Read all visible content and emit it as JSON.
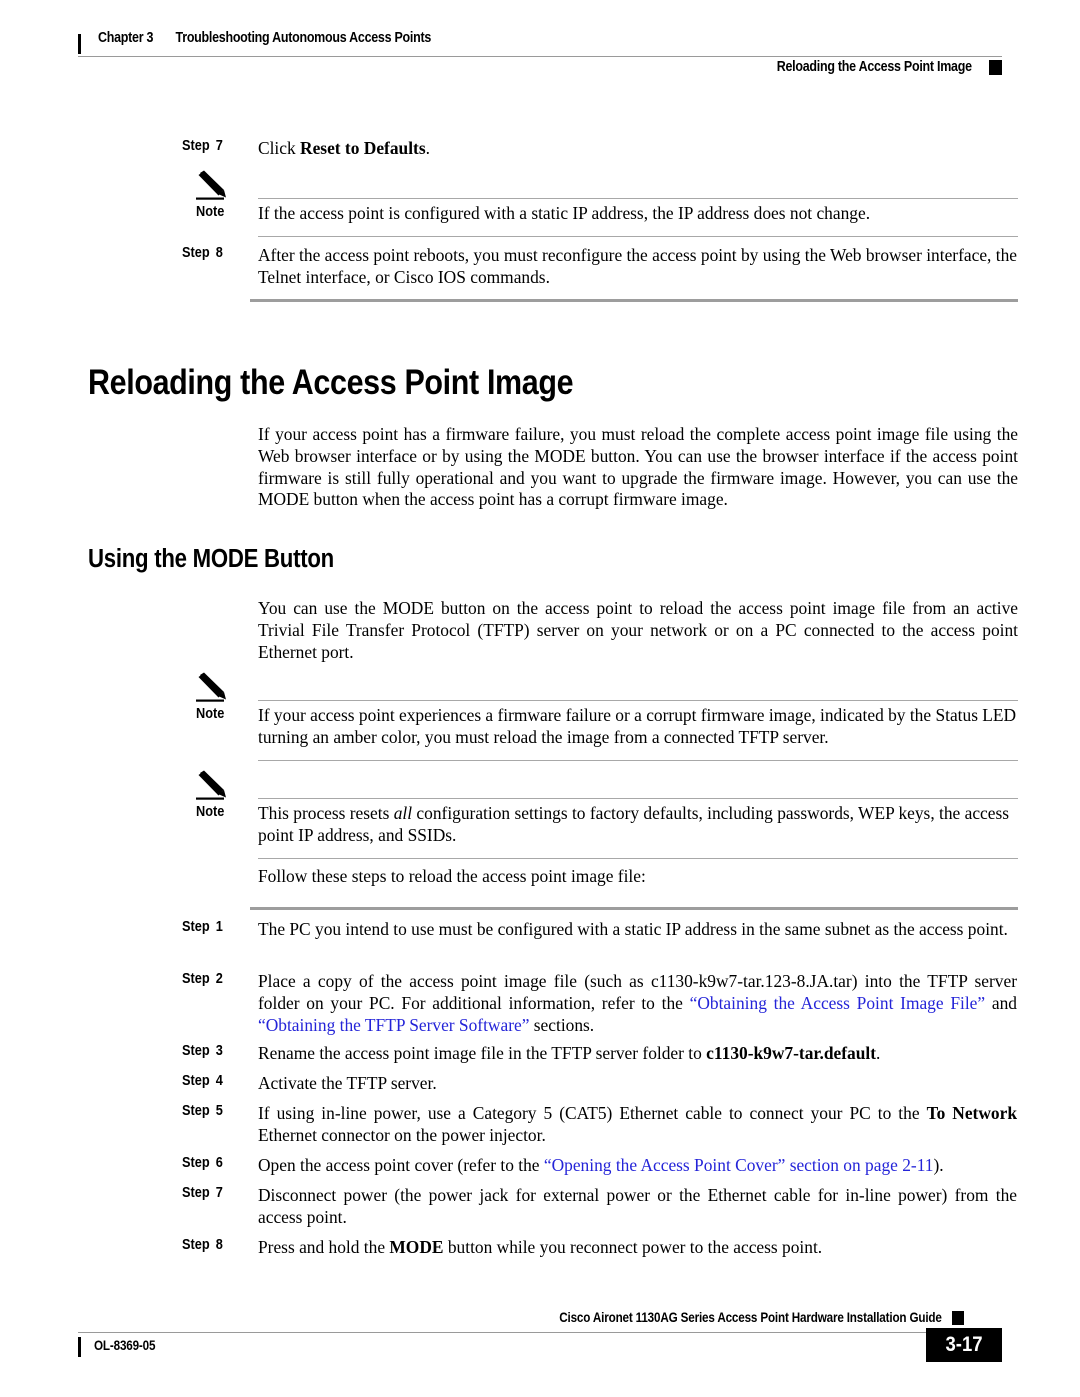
{
  "header": {
    "chapter_label": "Chapter 3",
    "chapter_title": "Troubleshooting Autonomous Access Points",
    "section_title": "Reloading the Access Point Image"
  },
  "top_steps": [
    {
      "label_word": "Step",
      "label_num": "7",
      "text_plain": "Click Reset to Defaults.",
      "text_lead": "Click ",
      "text_bold": "Reset to Defaults",
      "text_tail": "."
    },
    {
      "label_word": "Step",
      "label_num": "8",
      "text_plain": "After the access point reboots, you must reconfigure the access point by using the Web browser interface, the Telnet interface, or Cisco IOS commands."
    }
  ],
  "top_note": {
    "label": "Note",
    "icon": "pencil-icon",
    "text": "If the access point is configured with a static IP address, the IP address does not change."
  },
  "heading_1": "Reloading the Access Point Image",
  "intro_paragraph": "If your access point has a firmware failure, you must reload the complete access point image file using the Web browser interface or by using the MODE button. You can use the browser interface if the access point firmware is still fully operational and you want to upgrade the firmware image. However, you can use the MODE button when the access point has a corrupt firmware image.",
  "heading_2": "Using the MODE Button",
  "mode_paragraph": "You can use the MODE button on the access point to reload the access point image file from an active Trivial File Transfer Protocol (TFTP) server on your network or on a PC connected to the access point Ethernet port.",
  "notes": [
    {
      "label": "Note",
      "icon": "pencil-icon",
      "text": "If your access point experiences a firmware failure or a corrupt firmware image, indicated by the Status LED turning an amber color, you must reload the image from a connected TFTP server."
    },
    {
      "label": "Note",
      "icon": "pencil-icon",
      "text_lead": "This process resets ",
      "text_italic": "all",
      "text_tail": " configuration settings to factory defaults, including passwords, WEP keys, the access point IP address, and SSIDs.",
      "text": "This process resets all configuration settings to factory defaults, including passwords, WEP keys, the access point IP address, and SSIDs."
    }
  ],
  "follow_paragraph": "Follow these steps to reload the access point image file:",
  "procedure_steps": [
    {
      "label_word": "Step",
      "label_num": "1",
      "text": "The PC you intend to use must be configured with a static IP address in the same subnet as the access point."
    },
    {
      "label_word": "Step",
      "label_num": "2",
      "seg_1": "Place a copy of the access point image file (such as c1130-k9w7-tar.123-8.JA.tar) into the TFTP server folder on your PC. For additional information, refer to the ",
      "link_1": "“Obtaining the Access Point Image File”",
      "seg_2": " and ",
      "link_2": "“Obtaining the TFTP Server Software”",
      "seg_3": " sections.",
      "text": "Place a copy of the access point image file (such as c1130-k9w7-tar.123-8.JA.tar) into the TFTP server folder on your PC. For additional information, refer to the “Obtaining the Access Point Image File” and “Obtaining the TFTP Server Software” sections."
    },
    {
      "label_word": "Step",
      "label_num": "3",
      "seg_1": "Rename the access point image file in the TFTP server folder to ",
      "bold_1": "c1130-k9w7-tar.default",
      "seg_2": ".",
      "text": "Rename the access point image file in the TFTP server folder to c1130-k9w7-tar.default."
    },
    {
      "label_word": "Step",
      "label_num": "4",
      "text": "Activate the TFTP server."
    },
    {
      "label_word": "Step",
      "label_num": "5",
      "seg_1": "If using in-line power, use a Category 5 (CAT5) Ethernet cable to connect your PC to the ",
      "bold_1": "To Network",
      "seg_2": " Ethernet connector on the power injector.",
      "text": "If using in-line power, use a Category 5 (CAT5) Ethernet cable to connect your PC to the To Network Ethernet connector on the power injector."
    },
    {
      "label_word": "Step",
      "label_num": "6",
      "seg_1": "Open the access point cover (refer to the ",
      "link_1": "“Opening the Access Point Cover” section on page 2-11",
      "seg_2": ").",
      "text": "Open the access point cover (refer to the “Opening the Access Point Cover” section on page 2-11)."
    },
    {
      "label_word": "Step",
      "label_num": "7",
      "text": "Disconnect power (the power jack for external power or the Ethernet cable for in-line power) from the access point."
    },
    {
      "label_word": "Step",
      "label_num": "8",
      "seg_1": "Press and hold the ",
      "bold_1": "MODE",
      "seg_2": " button while you reconnect power to the access point.",
      "text": "Press and hold the MODE button while you reconnect power to the access point."
    }
  ],
  "footer": {
    "doc_id": "OL-8369-05",
    "guide_title": "Cisco Aironet 1130AG Series Access Point Hardware Installation Guide",
    "page_number": "3-17"
  },
  "colors": {
    "link": "#2424d8",
    "rule_gray": "#9d9d9d",
    "text": "#000000"
  }
}
